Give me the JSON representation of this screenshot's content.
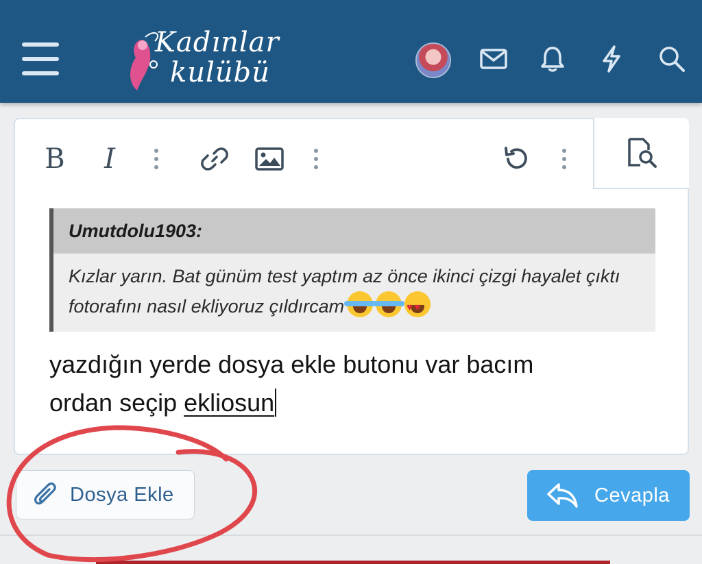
{
  "header": {
    "logo": {
      "line1": "Kadınlar",
      "line2": "kulübü"
    },
    "icons": [
      "menu-icon",
      "avatar",
      "envelope-icon",
      "bell-icon",
      "lightning-icon",
      "search-icon"
    ],
    "colors": {
      "background": "#1f5784",
      "icon": "#dbe8f3"
    }
  },
  "toolbar": {
    "bold_label": "B",
    "italic_label": "I",
    "icons": [
      "link-icon",
      "image-icon",
      "undo-icon",
      "more-icon",
      "preview-icon"
    ]
  },
  "quote": {
    "author": "Umutdolu1903:",
    "text": "Kızlar yarın. Bat günüm test yaptım az önce ikinci çizgi hayalet çıktı fotorafını nasıl ekliyoruz çıldırcam",
    "emojis": [
      "joy-emoji",
      "joy-emoji",
      "heart-eyes-emoji"
    ]
  },
  "message": {
    "line1": "yazdığın yerde dosya ekle butonu var bacım",
    "line2_prefix": "ordan seçip ",
    "line2_underlined": "ekliosun"
  },
  "actions": {
    "attach_label": "Dosya Ekle",
    "reply_label": "Cevapla",
    "reply_color": "#47a7eb"
  },
  "annotation": {
    "color": "#e0474c"
  }
}
